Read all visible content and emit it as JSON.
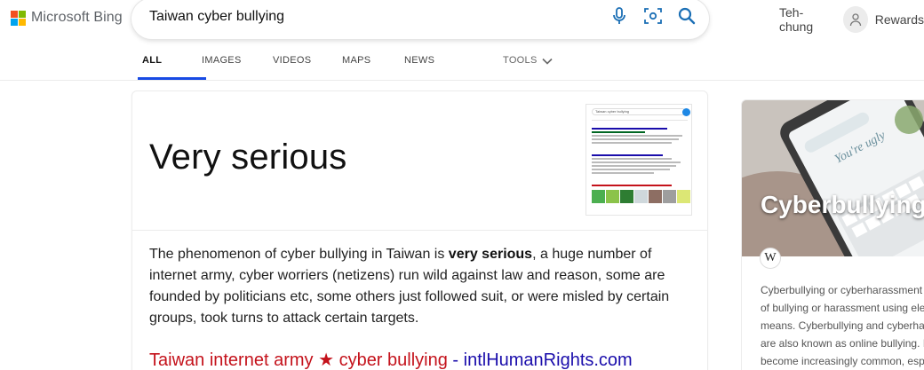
{
  "brand": {
    "name": "Microsoft Bing",
    "colors": [
      "#f25022",
      "#7fba00",
      "#00a4ef",
      "#ffb900"
    ]
  },
  "search": {
    "query": "Taiwan cyber bullying",
    "icons": [
      "microphone-icon",
      "visual-search-icon",
      "search-icon"
    ]
  },
  "user": {
    "name": "Teh-chung",
    "rewards_label": "Rewards"
  },
  "tabs": [
    {
      "label": "ALL",
      "active": true
    },
    {
      "label": "IMAGES",
      "active": false
    },
    {
      "label": "VIDEOS",
      "active": false
    },
    {
      "label": "MAPS",
      "active": false
    },
    {
      "label": "NEWS",
      "active": false
    }
  ],
  "tools_label": "TOOLS",
  "answer": {
    "headline": "Very serious",
    "text_before": "The phenomenon of cyber bullying in Taiwan is ",
    "text_bold": "very serious",
    "text_after": ", a huge number of internet army, cyber worriers (netizens) run wild against law and reason, some are founded by politicians etc, some others just followed suit, or were misled by certain groups, took turns to attack certain targets.",
    "link_title": "Taiwan internet army ★ cyber bullying",
    "link_separator": " - ",
    "link_site": "intlHumanRights.com",
    "thumbnail_query": "Taiwan cyber bullying"
  },
  "knowledge_panel": {
    "title": "Cyberbullying",
    "source_icon": "wikipedia-icon",
    "image_caption": "You're ugly",
    "description_lines": [
      "Cyberbullying or cyberharassment is a form",
      "of bullying or harassment using electronic",
      "means. Cyberbullying and cyberharassment",
      "are also known as online bullying. It has",
      "become increasingly common, especially"
    ]
  },
  "colors": {
    "accent": "#174ae4",
    "link_red": "#c4121b",
    "link_blue": "#1a0dab"
  }
}
